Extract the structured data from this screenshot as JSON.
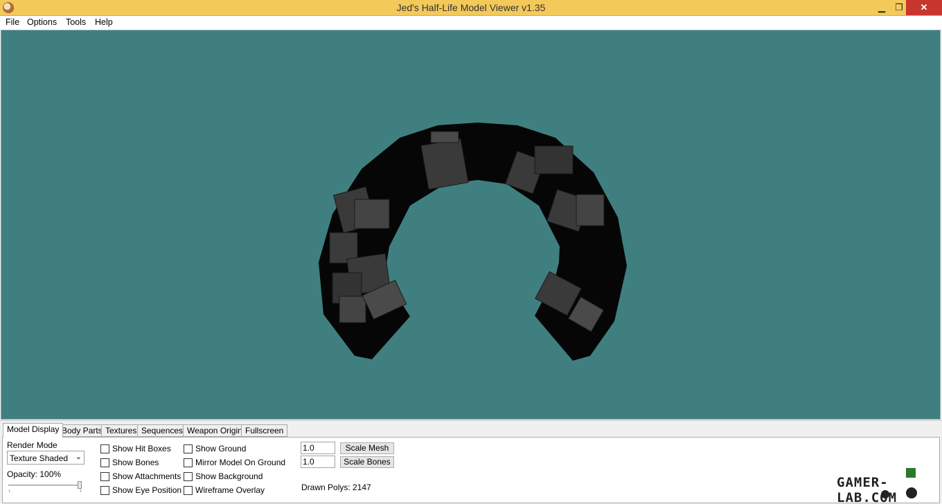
{
  "window": {
    "title": "Jed's Half-Life Model Viewer v1.35"
  },
  "menu": [
    "File",
    "Options",
    "Tools",
    "Help"
  ],
  "tabs": [
    "Model Display",
    "Body Parts",
    "Textures",
    "Sequences",
    "Weapon Origin",
    "Fullscreen"
  ],
  "active_tab": "Model Display",
  "model_display": {
    "render_mode_label": "Render Mode",
    "render_mode_value": "Texture Shaded",
    "opacity_label": "Opacity: 100%",
    "opacity_value": 1.0,
    "checkboxes_col1": [
      "Show Hit Boxes",
      "Show Bones",
      "Show Attachments",
      "Show Eye Position"
    ],
    "checkboxes_col2": [
      "Show Ground",
      "Mirror Model On Ground",
      "Show Background",
      "Wireframe Overlay"
    ],
    "scale_mesh_value": "1.0",
    "scale_mesh_button": "Scale Mesh",
    "scale_bones_value": "1.0",
    "scale_bones_button": "Scale Bones",
    "drawn_polys": "Drawn Polys: 2147"
  },
  "watermark": "GAMER-LAB.COM",
  "colors": {
    "titlebar": "#f3c95a",
    "viewport_bg": "#407f7f",
    "close_button": "#c7372f"
  }
}
